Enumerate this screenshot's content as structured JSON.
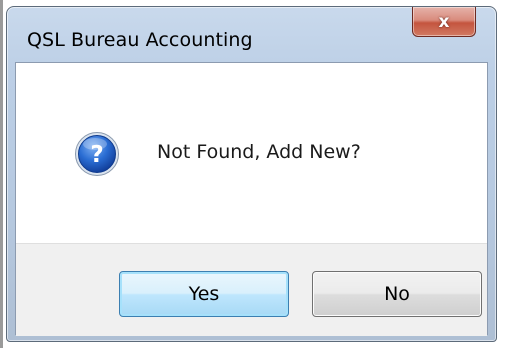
{
  "dialog": {
    "title": "QSL Bureau Accounting",
    "close_icon": "close-icon",
    "close_glyph": "x",
    "message_icon": "question-icon",
    "message": "Not Found, Add New?",
    "buttons": {
      "yes_label": "Yes",
      "no_label": "No"
    }
  },
  "colors": {
    "titlebar": "#bccfe6",
    "close_button": "#c4553f",
    "question_icon": "#1f5ec6",
    "default_button_border": "#3c7fb1"
  }
}
